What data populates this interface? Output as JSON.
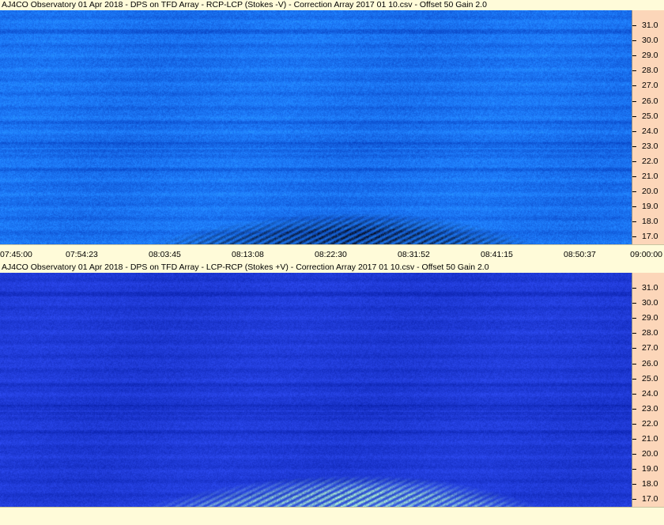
{
  "panels": [
    {
      "id": "top",
      "title": "AJ4CO Observatory 01 Apr 2018  -  DPS on TFD Array  -  RCP-LCP (Stokes -V)  -  Correction Array 2017 01 10.csv  -  Offset 50  Gain 2.0",
      "colors": {
        "base": "#1a72f0",
        "burst": "#06091a"
      },
      "burst_polarity": "dark",
      "time_labels": [
        "07:45:00",
        "07:54:23",
        "08:03:45",
        "08:13:08",
        "08:22:30",
        "08:31:52",
        "08:41:15",
        "08:50:37",
        "09:00:00"
      ]
    },
    {
      "id": "bottom",
      "title": "AJ4CO Observatory 01 Apr 2018  -  DPS on TFD Array  -  LCP-RCP (Stokes +V)  -  Correction Array 2017 01 10.csv  -  Offset 50  Gain 2.0",
      "colors": {
        "base": "#1f3ad6",
        "burst": "#b8ffd0"
      },
      "burst_polarity": "bright",
      "time_labels": []
    }
  ],
  "chart_data": [
    {
      "type": "heatmap",
      "title": "AJ4CO Observatory 01 Apr 2018  -  DPS on TFD Array  -  RCP-LCP (Stokes -V)  -  Correction Array 2017 01 10.csv  -  Offset 50  Gain 2.0",
      "xlabel": "",
      "ylabel": "",
      "x_ticks": [
        "07:45:00",
        "07:54:23",
        "08:03:45",
        "08:13:08",
        "08:22:30",
        "08:31:52",
        "08:41:15",
        "08:50:37",
        "09:00:00"
      ],
      "y_ticks": [
        "17.0",
        "18.0",
        "19.0",
        "20.0",
        "21.0",
        "22.0",
        "23.0",
        "24.0",
        "25.0",
        "26.0",
        "27.0",
        "28.0",
        "29.0",
        "30.0",
        "31.0"
      ],
      "y_range_mhz": [
        16.5,
        32.0
      ],
      "x_range": [
        "07:45:00",
        "09:00:00"
      ],
      "colormap": "blue",
      "burst": {
        "start": "08:02:00",
        "end": "08:49:00",
        "freq_min_mhz": 16.5,
        "freq_max_mhz": 18.6,
        "peak": "08:28:00",
        "appearance": "dark"
      }
    },
    {
      "type": "heatmap",
      "title": "AJ4CO Observatory 01 Apr 2018  -  DPS on TFD Array  -  LCP-RCP (Stokes +V)  -  Correction Array 2017 01 10.csv  -  Offset 50  Gain 2.0",
      "xlabel": "",
      "ylabel": "",
      "x_ticks": [],
      "y_ticks": [
        "17.0",
        "18.0",
        "19.0",
        "20.0",
        "21.0",
        "22.0",
        "23.0",
        "24.0",
        "25.0",
        "26.0",
        "27.0",
        "28.0",
        "29.0",
        "30.0",
        "31.0"
      ],
      "y_range_mhz": [
        16.5,
        32.0
      ],
      "x_range": [
        "07:45:00",
        "09:00:00"
      ],
      "colormap": "blue",
      "burst": {
        "start": "08:02:00",
        "end": "08:49:00",
        "freq_min_mhz": 16.5,
        "freq_max_mhz": 18.6,
        "peak": "08:28:00",
        "appearance": "bright"
      }
    }
  ]
}
